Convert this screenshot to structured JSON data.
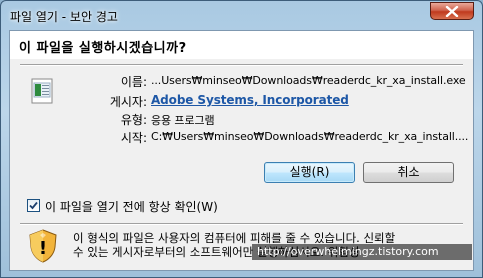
{
  "window": {
    "title": "파일 열기 - 보안 경고",
    "close_label": "close"
  },
  "dialog": {
    "question": "이 파일을 실행하시겠습니까?",
    "fields": [
      {
        "label": "이름:",
        "value": "...Users₩minseo₩Downloads₩readerdc_kr_xa_install.exe"
      },
      {
        "label": "게시자:",
        "value": "Adobe Systems, Incorporated"
      },
      {
        "label": "유형:",
        "value": "응용 프로그램"
      },
      {
        "label": "시작:",
        "value": "C:₩Users₩minseo₩Downloads₩readerdc_kr_xa_install...."
      }
    ],
    "run_button": "실행(R)",
    "cancel_button": "취소",
    "checkbox_label": "이 파일을 열기 전에 항상 확인(W)",
    "checkbox_checked": true,
    "warning_line1": "이 형식의 파일은 사용자의 컴퓨터에 피해를 줄 수 있습니다. 신뢰할",
    "warning_line2": "수 있는 게시자로부터의 소프트웨어만 실행하십시오. 위험성",
    "icons": {
      "file": "application-file-icon",
      "shield": "security-warning-shield-icon",
      "close": "close-icon",
      "check": "checkmark-icon"
    }
  },
  "watermark": "http://overwhelmingz.tistory.com",
  "colors": {
    "link": "#1d57a6",
    "close_button": "#c03a1e",
    "default_button_border": "#3c7fb1"
  }
}
